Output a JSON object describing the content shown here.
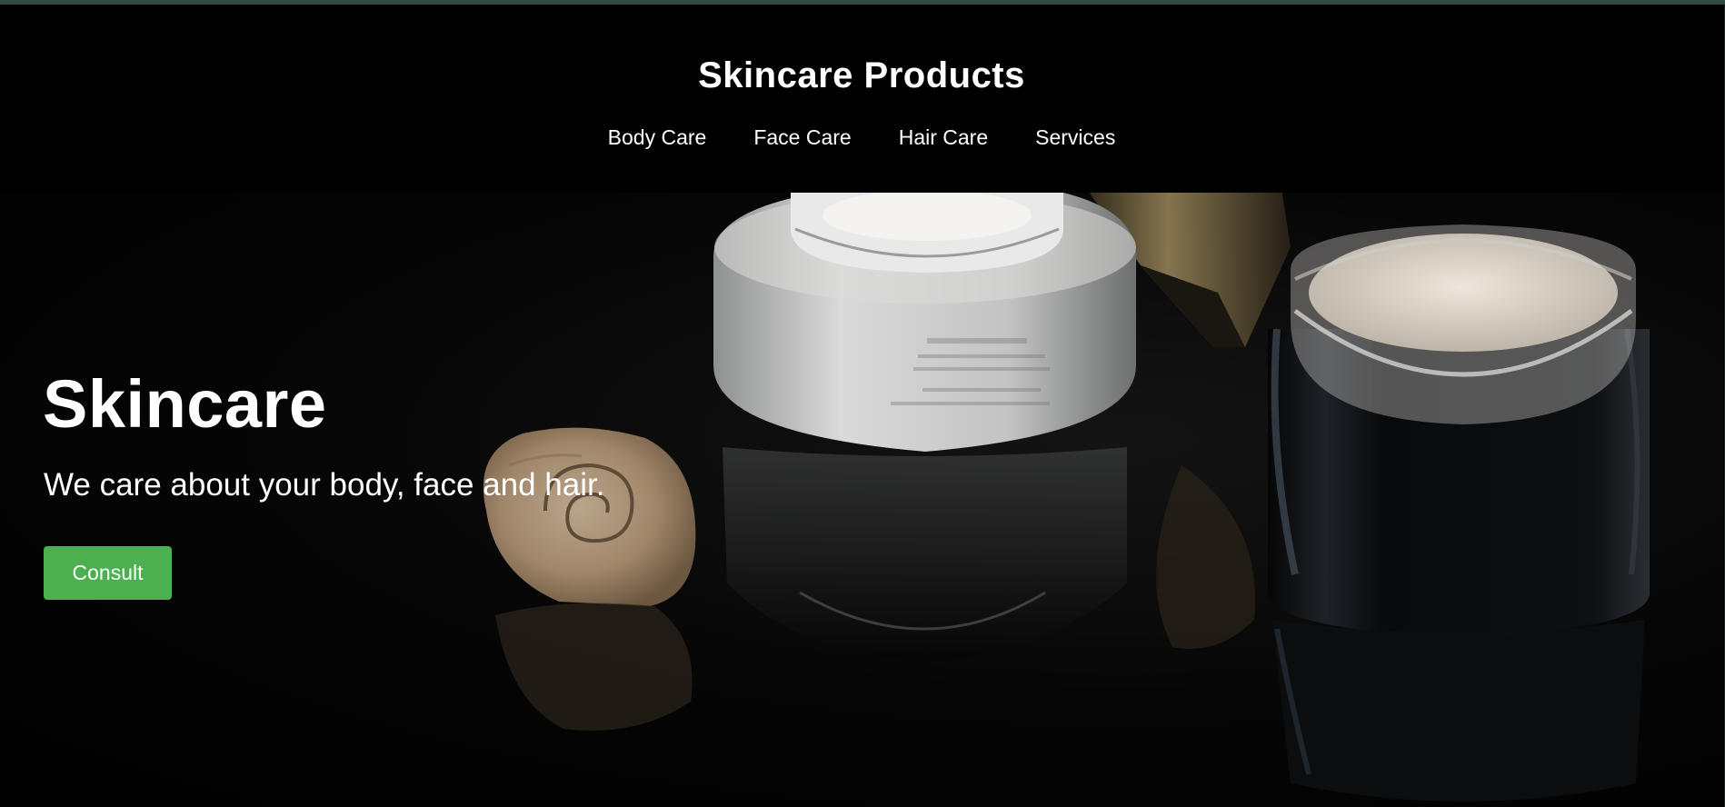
{
  "header": {
    "title": "Skincare Products",
    "nav": [
      "Body Care",
      "Face Care",
      "Hair Care",
      "Services"
    ]
  },
  "hero": {
    "title": "Skincare",
    "subtitle": "We care about your body, face and hair.",
    "button_label": "Consult"
  },
  "colors": {
    "accent_green": "#4caf50",
    "background": "#000000",
    "top_border": "#2f4a41"
  }
}
